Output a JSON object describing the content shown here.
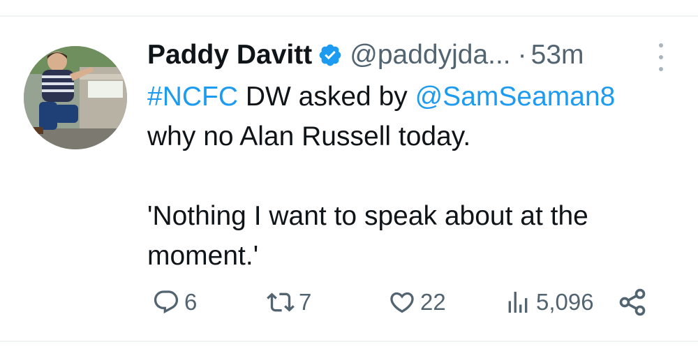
{
  "tweet": {
    "author_name": "Paddy Davitt",
    "handle": "@paddyjda...",
    "separator": "·",
    "time": "53m",
    "hashtag": "#NCFC",
    "text_part1": " DW asked by ",
    "mention": "@SamSeaman8",
    "line2": "why no Alan Russell today.",
    "line3": "'Nothing I want to speak about at the",
    "line4": "moment.'"
  },
  "actions": {
    "replies": "6",
    "retweets": "7",
    "likes": "22",
    "views": "5,096"
  },
  "icons": {
    "verified": "verified-badge-icon",
    "more": "more-vertical-icon",
    "reply": "reply-icon",
    "retweet": "retweet-icon",
    "like": "heart-icon",
    "views": "views-chart-icon",
    "share": "share-icon"
  },
  "colors": {
    "link": "#1d9bf0",
    "secondary_text": "#536471",
    "primary_text": "#0f1419"
  }
}
